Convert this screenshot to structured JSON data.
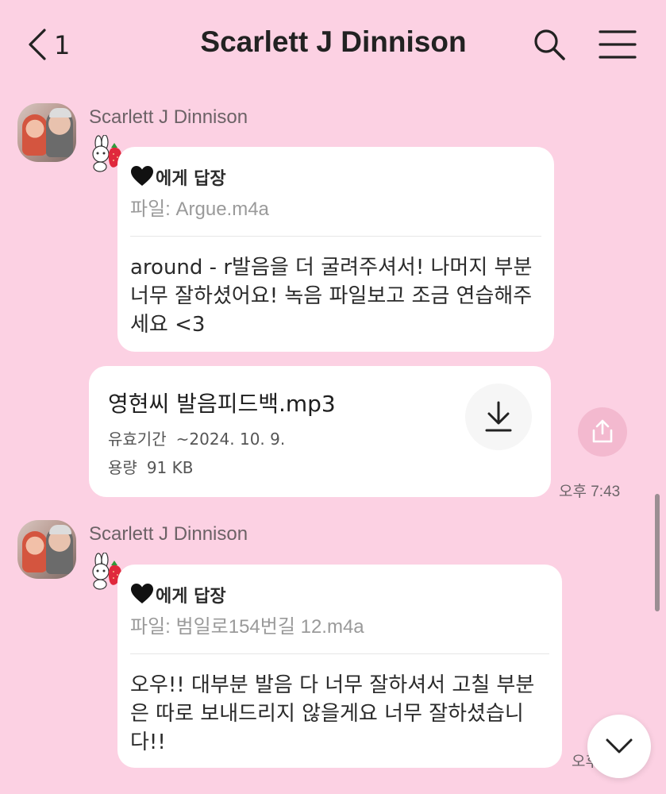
{
  "header": {
    "unread_count": "1",
    "title": "Scarlett J Dinnison"
  },
  "messages": [
    {
      "sender": "Scarlett J Dinnison",
      "reply_to": "에게 답장",
      "reply_file": "파일: Argue.m4a",
      "text": "around - r발음을 더 굴려주셔서! 나머지 부분 너무 잘하셨어요! 녹음 파일보고 조금 연습해주세요 <3"
    },
    {
      "file_name": "영현씨 발음피드백.mp3",
      "expiry_label": "유효기간",
      "expiry_value": "~2024. 10. 9.",
      "size_label": "용량",
      "size_value": "91 KB",
      "time": "오후 7:43"
    },
    {
      "sender": "Scarlett J Dinnison",
      "reply_to": "에게 답장",
      "reply_file": "파일: 범일로154번길 12.m4a",
      "text": "오우!! 대부분 발음 다 너무 잘하셔서 고칠 부분은 따로 보내드리지 않을게요 너무 잘하셨습니다!!",
      "time": "오후"
    }
  ],
  "icons": {
    "back": "chevron-left-icon",
    "search": "search-icon",
    "menu": "hamburger-menu-icon",
    "download": "download-icon",
    "share": "share-icon",
    "scroll_down": "chevron-down-icon",
    "heart": "black-heart-icon",
    "sticker": "bunny-strawberry-sticker"
  },
  "colors": {
    "background": "#fcd1e3",
    "bubble": "#ffffff",
    "share_button": "#f3b9cf"
  }
}
